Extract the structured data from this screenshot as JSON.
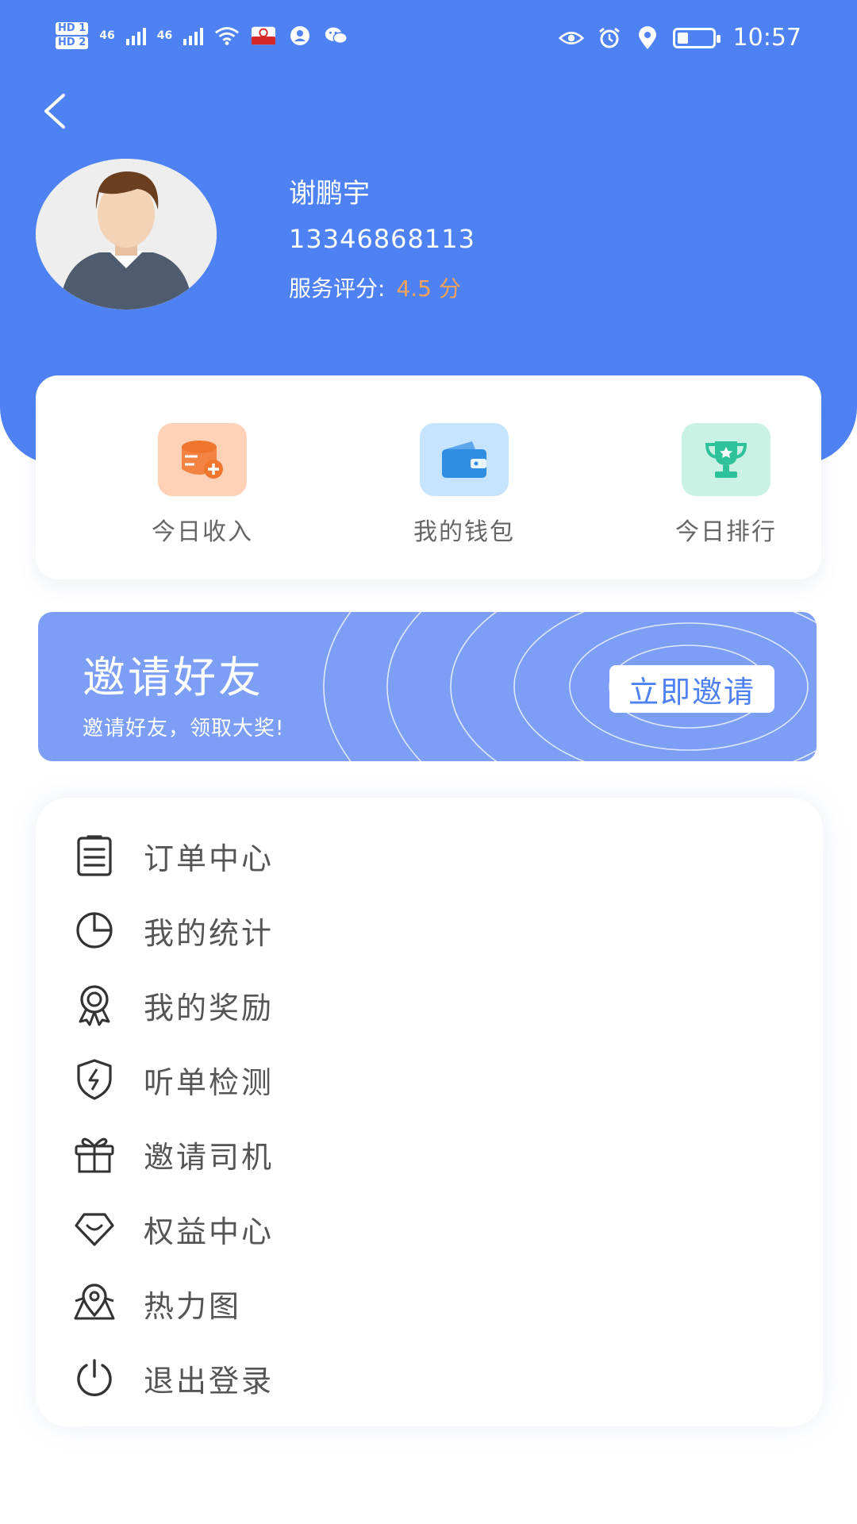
{
  "status_bar": {
    "hd1": "HD 1",
    "hd2": "HD 2",
    "sig1": "46",
    "sig2": "46",
    "time": "10:57",
    "battery_level": 0.3
  },
  "header": {
    "back_icon": "chevron-left-icon"
  },
  "profile": {
    "name": "谢鹏宇",
    "phone": "13346868113",
    "rating_label": "服务评分:",
    "rating_value": "4.5 分"
  },
  "quick_actions": [
    {
      "label": "今日收入",
      "icon": "coins-plus-icon",
      "tile_color": "#ffd2b8",
      "icon_color": "#f0762d"
    },
    {
      "label": "我的钱包",
      "icon": "wallet-icon",
      "tile_color": "#c6e4ff",
      "icon_color": "#2f8de4"
    },
    {
      "label": "今日排行",
      "icon": "trophy-icon",
      "tile_color": "#c9f2e4",
      "icon_color": "#2ec29a"
    }
  ],
  "invite": {
    "title": "邀请好友",
    "subtitle": "邀请好友，领取大奖!",
    "button": "立即邀请"
  },
  "menu": [
    {
      "label": "订单中心",
      "icon": "clipboard-icon"
    },
    {
      "label": "我的统计",
      "icon": "pie-chart-icon"
    },
    {
      "label": "我的奖励",
      "icon": "medal-icon"
    },
    {
      "label": "听单检测",
      "icon": "shield-bolt-icon"
    },
    {
      "label": "邀请司机",
      "icon": "gift-icon"
    },
    {
      "label": "权益中心",
      "icon": "diamond-icon"
    },
    {
      "label": "热力图",
      "icon": "map-pin-icon"
    },
    {
      "label": "退出登录",
      "icon": "power-icon"
    }
  ],
  "colors": {
    "primary": "#4e82f2",
    "banner": "#7c9ff5",
    "rating": "#f6a25a"
  }
}
